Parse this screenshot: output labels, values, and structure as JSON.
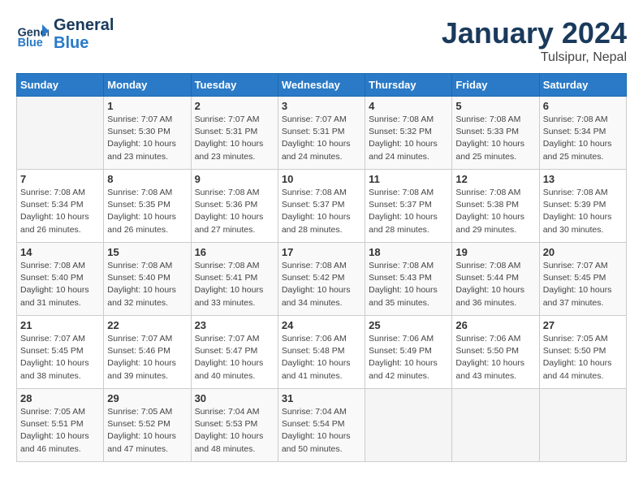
{
  "header": {
    "logo_general": "General",
    "logo_blue": "Blue",
    "month_title": "January 2024",
    "location": "Tulsipur, Nepal"
  },
  "days_of_week": [
    "Sunday",
    "Monday",
    "Tuesday",
    "Wednesday",
    "Thursday",
    "Friday",
    "Saturday"
  ],
  "weeks": [
    [
      {
        "day": "",
        "empty": true
      },
      {
        "day": "1",
        "sunrise": "7:07 AM",
        "sunset": "5:30 PM",
        "daylight": "10 hours and 23 minutes."
      },
      {
        "day": "2",
        "sunrise": "7:07 AM",
        "sunset": "5:31 PM",
        "daylight": "10 hours and 23 minutes."
      },
      {
        "day": "3",
        "sunrise": "7:07 AM",
        "sunset": "5:31 PM",
        "daylight": "10 hours and 24 minutes."
      },
      {
        "day": "4",
        "sunrise": "7:08 AM",
        "sunset": "5:32 PM",
        "daylight": "10 hours and 24 minutes."
      },
      {
        "day": "5",
        "sunrise": "7:08 AM",
        "sunset": "5:33 PM",
        "daylight": "10 hours and 25 minutes."
      },
      {
        "day": "6",
        "sunrise": "7:08 AM",
        "sunset": "5:34 PM",
        "daylight": "10 hours and 25 minutes."
      }
    ],
    [
      {
        "day": "7",
        "sunrise": "7:08 AM",
        "sunset": "5:34 PM",
        "daylight": "10 hours and 26 minutes."
      },
      {
        "day": "8",
        "sunrise": "7:08 AM",
        "sunset": "5:35 PM",
        "daylight": "10 hours and 26 minutes."
      },
      {
        "day": "9",
        "sunrise": "7:08 AM",
        "sunset": "5:36 PM",
        "daylight": "10 hours and 27 minutes."
      },
      {
        "day": "10",
        "sunrise": "7:08 AM",
        "sunset": "5:37 PM",
        "daylight": "10 hours and 28 minutes."
      },
      {
        "day": "11",
        "sunrise": "7:08 AM",
        "sunset": "5:37 PM",
        "daylight": "10 hours and 28 minutes."
      },
      {
        "day": "12",
        "sunrise": "7:08 AM",
        "sunset": "5:38 PM",
        "daylight": "10 hours and 29 minutes."
      },
      {
        "day": "13",
        "sunrise": "7:08 AM",
        "sunset": "5:39 PM",
        "daylight": "10 hours and 30 minutes."
      }
    ],
    [
      {
        "day": "14",
        "sunrise": "7:08 AM",
        "sunset": "5:40 PM",
        "daylight": "10 hours and 31 minutes."
      },
      {
        "day": "15",
        "sunrise": "7:08 AM",
        "sunset": "5:40 PM",
        "daylight": "10 hours and 32 minutes."
      },
      {
        "day": "16",
        "sunrise": "7:08 AM",
        "sunset": "5:41 PM",
        "daylight": "10 hours and 33 minutes."
      },
      {
        "day": "17",
        "sunrise": "7:08 AM",
        "sunset": "5:42 PM",
        "daylight": "10 hours and 34 minutes."
      },
      {
        "day": "18",
        "sunrise": "7:08 AM",
        "sunset": "5:43 PM",
        "daylight": "10 hours and 35 minutes."
      },
      {
        "day": "19",
        "sunrise": "7:08 AM",
        "sunset": "5:44 PM",
        "daylight": "10 hours and 36 minutes."
      },
      {
        "day": "20",
        "sunrise": "7:07 AM",
        "sunset": "5:45 PM",
        "daylight": "10 hours and 37 minutes."
      }
    ],
    [
      {
        "day": "21",
        "sunrise": "7:07 AM",
        "sunset": "5:45 PM",
        "daylight": "10 hours and 38 minutes."
      },
      {
        "day": "22",
        "sunrise": "7:07 AM",
        "sunset": "5:46 PM",
        "daylight": "10 hours and 39 minutes."
      },
      {
        "day": "23",
        "sunrise": "7:07 AM",
        "sunset": "5:47 PM",
        "daylight": "10 hours and 40 minutes."
      },
      {
        "day": "24",
        "sunrise": "7:06 AM",
        "sunset": "5:48 PM",
        "daylight": "10 hours and 41 minutes."
      },
      {
        "day": "25",
        "sunrise": "7:06 AM",
        "sunset": "5:49 PM",
        "daylight": "10 hours and 42 minutes."
      },
      {
        "day": "26",
        "sunrise": "7:06 AM",
        "sunset": "5:50 PM",
        "daylight": "10 hours and 43 minutes."
      },
      {
        "day": "27",
        "sunrise": "7:05 AM",
        "sunset": "5:50 PM",
        "daylight": "10 hours and 44 minutes."
      }
    ],
    [
      {
        "day": "28",
        "sunrise": "7:05 AM",
        "sunset": "5:51 PM",
        "daylight": "10 hours and 46 minutes."
      },
      {
        "day": "29",
        "sunrise": "7:05 AM",
        "sunset": "5:52 PM",
        "daylight": "10 hours and 47 minutes."
      },
      {
        "day": "30",
        "sunrise": "7:04 AM",
        "sunset": "5:53 PM",
        "daylight": "10 hours and 48 minutes."
      },
      {
        "day": "31",
        "sunrise": "7:04 AM",
        "sunset": "5:54 PM",
        "daylight": "10 hours and 50 minutes."
      },
      {
        "day": "",
        "empty": true
      },
      {
        "day": "",
        "empty": true
      },
      {
        "day": "",
        "empty": true
      }
    ]
  ]
}
